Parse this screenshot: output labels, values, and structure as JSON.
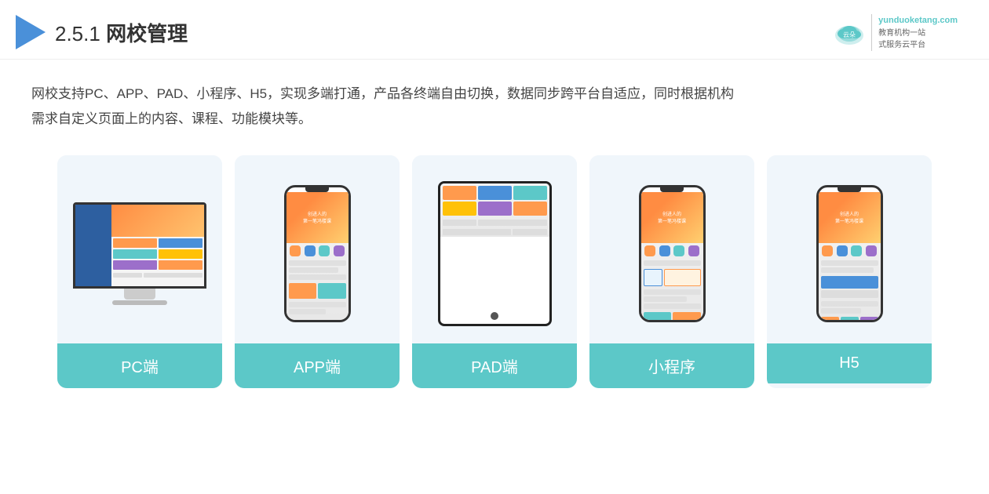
{
  "header": {
    "title_prefix": "2.5.1 ",
    "title_main": "网校管理",
    "brand_name": "云朵课堂",
    "brand_domain": "yunduoketang.com",
    "brand_tagline1": "教育机构一站",
    "brand_tagline2": "式服务云平台"
  },
  "description": {
    "line1": "网校支持PC、APP、PAD、小程序、H5，实现多端打通，产品各终端自由切换，数据同步跨平台自适应，同时根据机构",
    "line2": "需求自定义页面上的内容、课程、功能模块等。"
  },
  "cards": [
    {
      "id": "pc",
      "label": "PC端"
    },
    {
      "id": "app",
      "label": "APP端"
    },
    {
      "id": "pad",
      "label": "PAD端"
    },
    {
      "id": "miniprogram",
      "label": "小程序"
    },
    {
      "id": "h5",
      "label": "H5"
    }
  ]
}
